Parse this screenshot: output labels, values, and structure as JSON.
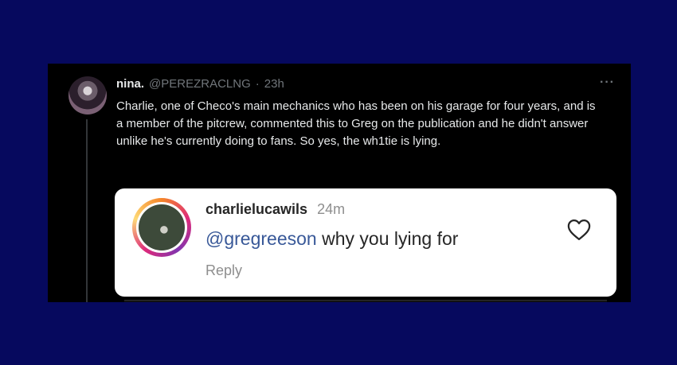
{
  "tweet": {
    "display_name": "nina.",
    "handle": "@PEREZRACLNG",
    "separator": "·",
    "time": "23h",
    "more_label": "···",
    "text": "Charlie, one of Checo's main mechanics who has been on his garage for four years, and is a member of the pitcrew, commented this to Greg on the publication and he didn't answer unlike he's currently doing to fans. So yes, the wh1tie is lying."
  },
  "embedded_comment": {
    "username": "charlielucawils",
    "time": "24m",
    "mention": "@gregreeson",
    "comment": " why you lying for",
    "reply_label": "Reply",
    "icon": "heart-icon"
  },
  "colors": {
    "background": "#06095e",
    "card": "#000000",
    "mention": "#385898"
  }
}
